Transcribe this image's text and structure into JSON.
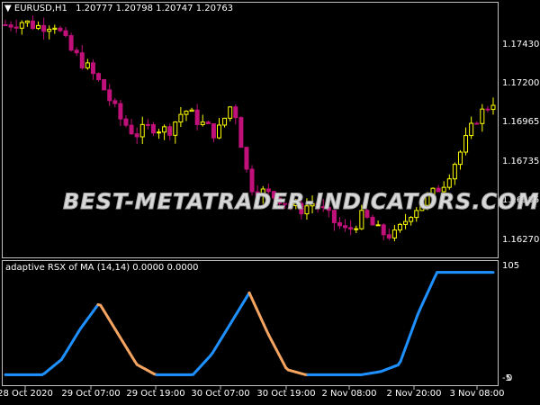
{
  "main_pane": {
    "symbol": "EURUSD,H1",
    "ohlc": "1.20777 1.20798 1.20747 1.20763",
    "price_labels": [
      "1.17430",
      "1.17200",
      "1.16965",
      "1.16735",
      "1.16505",
      "1.16270"
    ],
    "watermark": "BEST-METATRADER-INDICATORS.COM"
  },
  "sub_pane": {
    "title": "adaptive RSX of MA (14,14) 0.0000 0.0000",
    "scale_top": "105",
    "scale_bottom_a": "-5",
    "scale_bottom_b": "0"
  },
  "time_labels": [
    "28 Oct 2020",
    "29 Oct 07:00",
    "29 Oct 19:00",
    "30 Oct 07:00",
    "30 Oct 19:00",
    "2 Nov 08:00",
    "2 Nov 20:00",
    "3 Nov 08:00"
  ],
  "colors": {
    "bull": "#ffff00",
    "bear": "#c0107a",
    "rise": "#1e90ff",
    "fall": "#f4a460",
    "frame": "#c0c0c0"
  },
  "chart_data": {
    "type": "line",
    "price_keypoints": [
      1.1755,
      1.1757,
      1.1754,
      1.1756,
      1.174,
      1.173,
      1.1718,
      1.17,
      1.169,
      1.1695,
      1.1692,
      1.1705,
      1.1697,
      1.169,
      1.171,
      1.166,
      1.1655,
      1.1652,
      1.1645,
      1.165,
      1.164,
      1.1632,
      1.1642,
      1.1632,
      1.163,
      1.1645,
      1.1652,
      1.1662,
      1.168,
      1.17,
      1.171
    ],
    "rsx_keypoints": [
      0,
      0,
      0,
      15,
      45,
      70,
      40,
      10,
      0,
      0,
      0,
      20,
      50,
      80,
      40,
      5,
      0,
      0,
      0,
      0,
      3,
      10,
      60,
      100,
      100,
      100,
      100
    ],
    "rsx_range": [
      -5,
      105
    ]
  }
}
